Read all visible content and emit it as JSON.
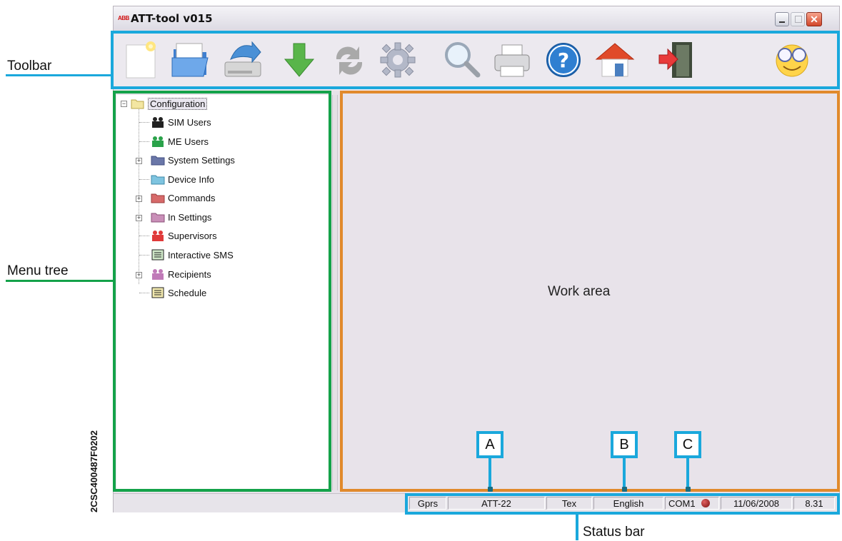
{
  "window": {
    "logo_text": "ABB",
    "title": "ATT-tool v015",
    "close_glyph": "✕"
  },
  "toolbar": {
    "items": [
      {
        "name": "new-document-icon"
      },
      {
        "name": "open-folder-icon"
      },
      {
        "name": "save-drive-icon"
      },
      {
        "name": "download-arrow-icon"
      },
      {
        "name": "refresh-icon"
      },
      {
        "name": "settings-gear-icon"
      },
      {
        "name": "search-icon"
      },
      {
        "name": "print-icon"
      },
      {
        "name": "help-icon"
      },
      {
        "name": "home-icon"
      },
      {
        "name": "exit-icon"
      },
      {
        "name": "smiley-glasses-icon"
      }
    ]
  },
  "tree": {
    "root": "Configuration",
    "items": [
      {
        "label": "SIM Users",
        "icon": "users-icon"
      },
      {
        "label": "ME Users",
        "icon": "users-icon"
      },
      {
        "label": "System Settings",
        "icon": "folder-icon"
      },
      {
        "label": "Device Info",
        "icon": "folder-icon"
      },
      {
        "label": "Commands",
        "icon": "folder-icon"
      },
      {
        "label": "In Settings",
        "icon": "folder-icon"
      },
      {
        "label": "Supervisors",
        "icon": "users-icon"
      },
      {
        "label": "Interactive SMS",
        "icon": "document-icon"
      },
      {
        "label": "Recipients",
        "icon": "users-icon"
      },
      {
        "label": "Schedule",
        "icon": "document-icon"
      }
    ]
  },
  "work_area": {
    "label": "Work area"
  },
  "status_bar": {
    "mode": "Gprs",
    "device": "ATT-22",
    "format": "Tex",
    "language": "English",
    "port": "COM1",
    "date": "11/06/2008",
    "time": "8.31"
  },
  "annotations": {
    "toolbar": "Toolbar",
    "menu_tree": "Menu tree",
    "status_bar": "Status bar",
    "marker_a": "A",
    "marker_b": "B",
    "marker_c": "C",
    "figure_code": "2CSC400487F0202"
  },
  "colors": {
    "toolbar_frame": "#1aa8dc",
    "menu_frame": "#14a24a",
    "work_frame": "#e18a2c"
  }
}
